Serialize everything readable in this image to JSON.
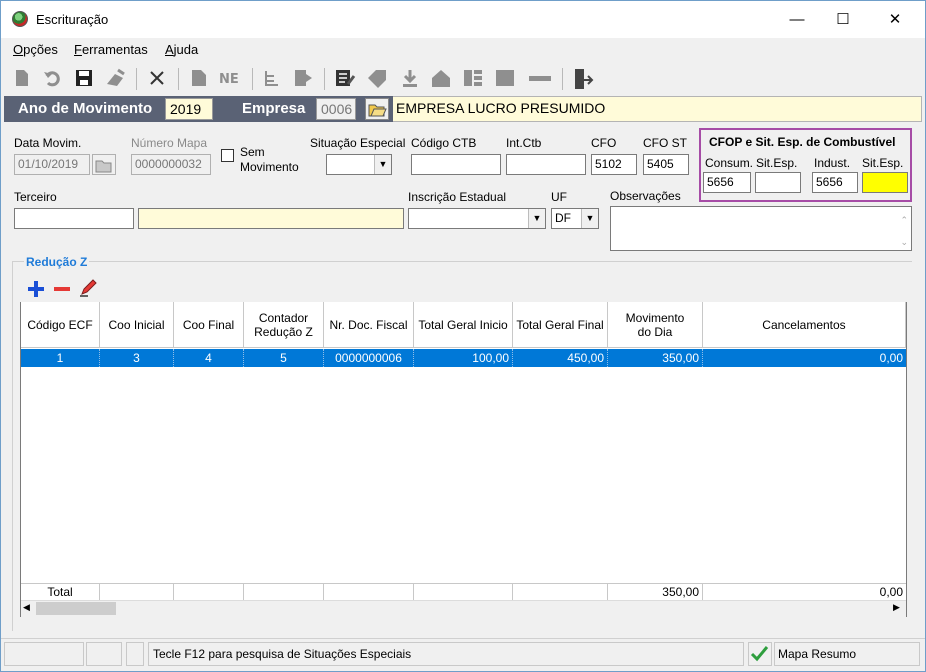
{
  "window": {
    "title": "Escrituração",
    "minimize": "—",
    "maximize": "☐",
    "close": "✕"
  },
  "menu": [
    {
      "label_rest": "pções",
      "mnemonic": "O"
    },
    {
      "label_rest": "erramentas",
      "mnemonic": "F"
    },
    {
      "label_rest": "juda",
      "mnemonic": "A"
    }
  ],
  "header": {
    "ano_label": "Ano de Movimento",
    "ano_value": "2019",
    "empresa_label": "Empresa",
    "empresa_code": "0006",
    "empresa_name": "EMPRESA LUCRO PRESUMIDO"
  },
  "form": {
    "data_movim_label": "Data Movim.",
    "data_movim_value": "01/10/2019",
    "numero_mapa_label": "Número Mapa",
    "numero_mapa_value": "0000000032",
    "sem_movimento_label_1": "Sem",
    "sem_movimento_label_2": "Movimento",
    "situacao_especial_label": "Situação Especial",
    "codigo_ctb_label": "Código CTB",
    "int_ctb_label": "Int.Ctb",
    "cfo_label": "CFO",
    "cfo_value": "5102",
    "cfo_st_label": "CFO ST",
    "cfo_st_value": "5405",
    "terceiro_label": "Terceiro",
    "inscricao_label": "Inscrição Estadual",
    "uf_label": "UF",
    "uf_value": "DF",
    "observacoes_label": "Observações"
  },
  "cfop_group": {
    "title": "CFOP e Sit. Esp. de Combustível",
    "consum_label": "Consum.",
    "consum_value": "5656",
    "sitesp1_label": "Sit.Esp.",
    "sitesp1_value": "",
    "indust_label": "Indust.",
    "indust_value": "5656",
    "sitesp2_label": "Sit.Esp.",
    "sitesp2_value": ""
  },
  "reducao": {
    "title": "Redução Z",
    "columns": [
      "Código ECF",
      "Coo Inicial",
      "Coo Final",
      "Contador Redução Z",
      "Nr. Doc. Fiscal",
      "Total Geral Inicio",
      "Total Geral Final",
      "Movimento do Dia",
      "Cancelamentos"
    ],
    "rows": [
      [
        "1",
        "3",
        "4",
        "5",
        "0000000006",
        "100,00",
        "450,00",
        "350,00",
        "0,00"
      ]
    ],
    "footer": {
      "label": "Total",
      "movimento": "350,00",
      "cancelamentos": "0,00"
    }
  },
  "status": {
    "hint": "Tecle F12 para pesquisa de Situações Especiais",
    "right": "Mapa Resumo"
  },
  "colors": {
    "header_dark": "#5a6275",
    "header_yellow": "#fffbd9",
    "selection": "#0078d7",
    "group_border": "#a64ca6",
    "section_blue": "#1f7bd8"
  }
}
